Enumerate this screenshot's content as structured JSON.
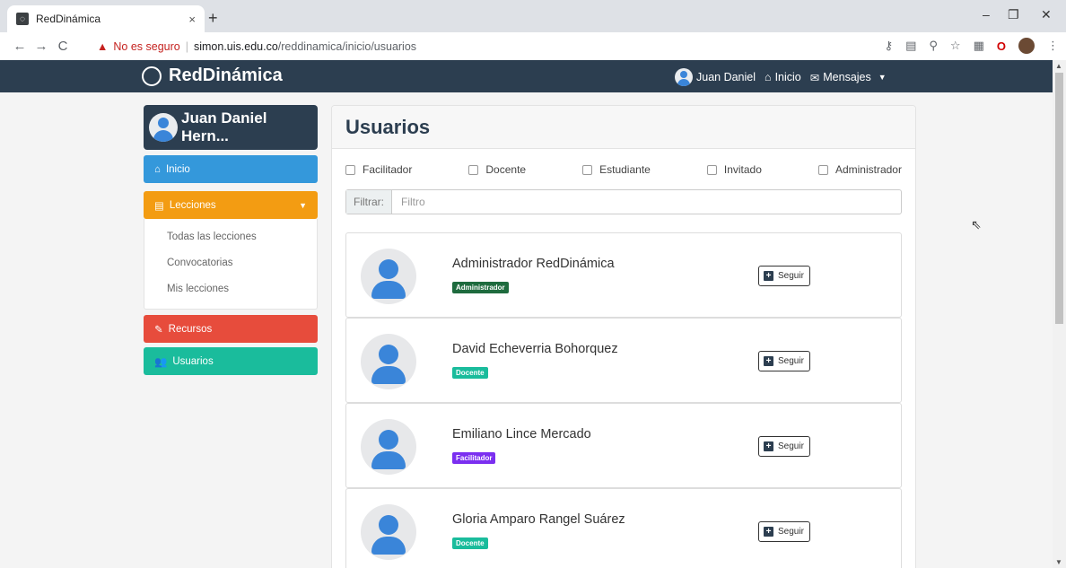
{
  "browser": {
    "tab_title": "RedDinámica",
    "tab_close": "×",
    "new_tab": "+",
    "window_controls": [
      "–",
      "❐",
      "✕"
    ],
    "nav_buttons": [
      "←",
      "→",
      "C"
    ],
    "security_label": "No es seguro",
    "url_host": "simon.uis.edu.co",
    "url_path": "/reddinamica/inicio/usuarios"
  },
  "navbar": {
    "brand": "RedDinámica",
    "user_name": "Juan Daniel",
    "inicio": "Inicio",
    "mensajes": "Mensajes"
  },
  "sidebar": {
    "profile_name": "Juan Daniel Hern...",
    "inicio": "Inicio",
    "lecciones": "Lecciones",
    "sub_items": [
      "Todas las lecciones",
      "Convocatorias",
      "Mis lecciones"
    ],
    "recursos": "Recursos",
    "usuarios": "Usuarios"
  },
  "main": {
    "title": "Usuarios",
    "filters": [
      "Facilitador",
      "Docente",
      "Estudiante",
      "Invitado",
      "Administrador"
    ],
    "filter_label": "Filtrar:",
    "filter_placeholder": "Filtro",
    "follow_label": "Seguir",
    "users": [
      {
        "name": "Administrador RedDinámica",
        "role": "Administrador",
        "role_color": "#1e6b3e"
      },
      {
        "name": "David Echeverria Bohorquez",
        "role": "Docente",
        "role_color": "#1abc9c"
      },
      {
        "name": "Emiliano Lince Mercado",
        "role": "Facilitador",
        "role_color": "#7b2ff0"
      },
      {
        "name": "Gloria Amparo Rangel Suárez",
        "role": "Docente",
        "role_color": "#1abc9c"
      }
    ]
  },
  "colors": {
    "navbar": "#2c3e50",
    "inicio": "#3498db",
    "lecciones": "#f39c12",
    "recursos": "#e74c3c",
    "usuarios": "#1abc9c"
  }
}
